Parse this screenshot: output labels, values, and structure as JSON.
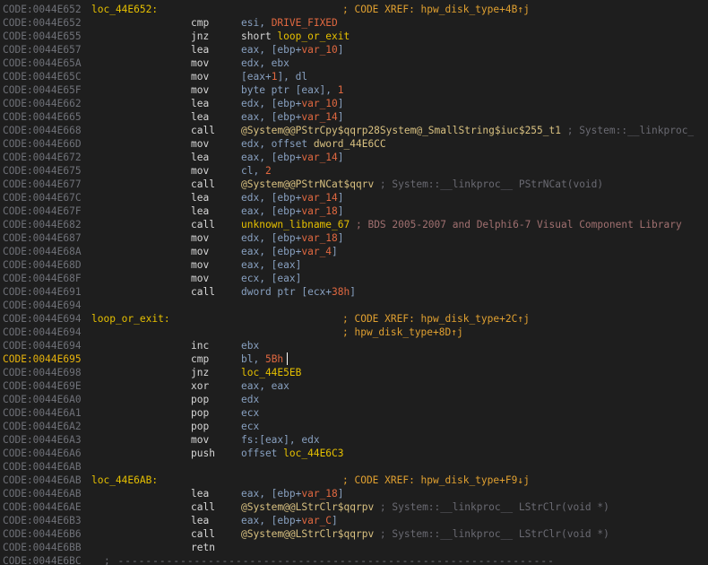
{
  "lines": [
    {
      "addr": "CODE:0044E652",
      "label": "loc_44E652:",
      "xref": "; CODE XREF: hpw_disk_type+4B↑j"
    },
    {
      "addr": "CODE:0044E652",
      "mn": "cmp",
      "ops": [
        {
          "t": "esi, ",
          "c": "r"
        },
        {
          "t": "DRIVE_FIXED",
          "c": "c"
        }
      ]
    },
    {
      "addr": "CODE:0044E655",
      "mn": "jnz",
      "ops": [
        {
          "t": "short ",
          "c": "t"
        },
        {
          "t": "loop_or_exit",
          "c": "f"
        }
      ]
    },
    {
      "addr": "CODE:0044E657",
      "mn": "lea",
      "ops": [
        {
          "t": "eax, [ebp+",
          "c": "r"
        },
        {
          "t": "var_10",
          "c": "v"
        },
        {
          "t": "]",
          "c": "r"
        }
      ]
    },
    {
      "addr": "CODE:0044E65A",
      "mn": "mov",
      "ops": [
        {
          "t": "edx, ebx",
          "c": "r"
        }
      ]
    },
    {
      "addr": "CODE:0044E65C",
      "mn": "mov",
      "ops": [
        {
          "t": "[eax+",
          "c": "r"
        },
        {
          "t": "1",
          "c": "c"
        },
        {
          "t": "], dl",
          "c": "r"
        }
      ]
    },
    {
      "addr": "CODE:0044E65F",
      "mn": "mov",
      "ops": [
        {
          "t": "byte ptr [eax], ",
          "c": "r"
        },
        {
          "t": "1",
          "c": "c"
        }
      ]
    },
    {
      "addr": "CODE:0044E662",
      "mn": "lea",
      "ops": [
        {
          "t": "edx, [ebp+",
          "c": "r"
        },
        {
          "t": "var_10",
          "c": "v"
        },
        {
          "t": "]",
          "c": "r"
        }
      ]
    },
    {
      "addr": "CODE:0044E665",
      "mn": "lea",
      "ops": [
        {
          "t": "eax, [ebp+",
          "c": "r"
        },
        {
          "t": "var_14",
          "c": "v"
        },
        {
          "t": "]",
          "c": "r"
        }
      ]
    },
    {
      "addr": "CODE:0044E668",
      "mn": "call",
      "ops": [
        {
          "t": "@System@@PStrCpy$qqrp28System@_SmallString$iuc$255_t1",
          "c": "fnc"
        },
        {
          "t": " ; System::__linkproc_",
          "c": "cm"
        }
      ]
    },
    {
      "addr": "CODE:0044E66D",
      "mn": "mov",
      "ops": [
        {
          "t": "edx, offset ",
          "c": "r"
        },
        {
          "t": "dword_44E6CC",
          "c": "fnc"
        }
      ]
    },
    {
      "addr": "CODE:0044E672",
      "mn": "lea",
      "ops": [
        {
          "t": "eax, [ebp+",
          "c": "r"
        },
        {
          "t": "var_14",
          "c": "v"
        },
        {
          "t": "]",
          "c": "r"
        }
      ]
    },
    {
      "addr": "CODE:0044E675",
      "mn": "mov",
      "ops": [
        {
          "t": "cl, ",
          "c": "r"
        },
        {
          "t": "2",
          "c": "c"
        }
      ]
    },
    {
      "addr": "CODE:0044E677",
      "mn": "call",
      "ops": [
        {
          "t": "@System@@PStrNCat$qqrv",
          "c": "fnc"
        },
        {
          "t": " ; System::__linkproc__ PStrNCat(void)",
          "c": "cm"
        }
      ]
    },
    {
      "addr": "CODE:0044E67C",
      "mn": "lea",
      "ops": [
        {
          "t": "edx, [ebp+",
          "c": "r"
        },
        {
          "t": "var_14",
          "c": "v"
        },
        {
          "t": "]",
          "c": "r"
        }
      ]
    },
    {
      "addr": "CODE:0044E67F",
      "mn": "lea",
      "ops": [
        {
          "t": "eax, [ebp+",
          "c": "r"
        },
        {
          "t": "var_18",
          "c": "v"
        },
        {
          "t": "]",
          "c": "r"
        }
      ]
    },
    {
      "addr": "CODE:0044E682",
      "mn": "call",
      "ops": [
        {
          "t": "unknown_libname_67",
          "c": "f"
        },
        {
          "t": " ; BDS 2005-2007 and Delphi6-7 Visual Component Library",
          "c": "cm2"
        }
      ]
    },
    {
      "addr": "CODE:0044E687",
      "mn": "mov",
      "ops": [
        {
          "t": "edx, [ebp+",
          "c": "r"
        },
        {
          "t": "var_18",
          "c": "v"
        },
        {
          "t": "]",
          "c": "r"
        }
      ]
    },
    {
      "addr": "CODE:0044E68A",
      "mn": "mov",
      "ops": [
        {
          "t": "eax, [ebp+",
          "c": "r"
        },
        {
          "t": "var_4",
          "c": "v"
        },
        {
          "t": "]",
          "c": "r"
        }
      ]
    },
    {
      "addr": "CODE:0044E68D",
      "mn": "mov",
      "ops": [
        {
          "t": "eax, [eax]",
          "c": "r"
        }
      ]
    },
    {
      "addr": "CODE:0044E68F",
      "mn": "mov",
      "ops": [
        {
          "t": "ecx, [eax]",
          "c": "r"
        }
      ]
    },
    {
      "addr": "CODE:0044E691",
      "mn": "call",
      "ops": [
        {
          "t": "dword ptr [ecx+",
          "c": "r"
        },
        {
          "t": "38h",
          "c": "c"
        },
        {
          "t": "]",
          "c": "r"
        }
      ]
    },
    {
      "addr": "CODE:0044E694"
    },
    {
      "addr": "CODE:0044E694",
      "label": "loop_or_exit:",
      "xref": "; CODE XREF: hpw_disk_type+2C↑j"
    },
    {
      "addr": "CODE:0044E694",
      "xref": "; hpw_disk_type+8D↑j"
    },
    {
      "addr": "CODE:0044E694",
      "mn": "inc",
      "ops": [
        {
          "t": "ebx",
          "c": "r"
        }
      ]
    },
    {
      "addr": "CODE:0044E695",
      "current": true,
      "mn": "cmp",
      "caret": true,
      "ops": [
        {
          "t": "bl, ",
          "c": "r"
        },
        {
          "t": "5Bh",
          "c": "c"
        }
      ]
    },
    {
      "addr": "CODE:0044E698",
      "mn": "jnz",
      "ops": [
        {
          "t": "loc_44E5EB",
          "c": "f"
        }
      ]
    },
    {
      "addr": "CODE:0044E69E",
      "mn": "xor",
      "ops": [
        {
          "t": "eax, eax",
          "c": "r"
        }
      ]
    },
    {
      "addr": "CODE:0044E6A0",
      "mn": "pop",
      "ops": [
        {
          "t": "edx",
          "c": "r"
        }
      ]
    },
    {
      "addr": "CODE:0044E6A1",
      "mn": "pop",
      "ops": [
        {
          "t": "ecx",
          "c": "r"
        }
      ]
    },
    {
      "addr": "CODE:0044E6A2",
      "mn": "pop",
      "ops": [
        {
          "t": "ecx",
          "c": "r"
        }
      ]
    },
    {
      "addr": "CODE:0044E6A3",
      "mn": "mov",
      "ops": [
        {
          "t": "fs:[eax], edx",
          "c": "r"
        }
      ]
    },
    {
      "addr": "CODE:0044E6A6",
      "mn": "push",
      "ops": [
        {
          "t": "offset ",
          "c": "r"
        },
        {
          "t": "loc_44E6C3",
          "c": "f"
        }
      ]
    },
    {
      "addr": "CODE:0044E6AB"
    },
    {
      "addr": "CODE:0044E6AB",
      "label": "loc_44E6AB:",
      "xref": "; CODE XREF: hpw_disk_type+F9↓j"
    },
    {
      "addr": "CODE:0044E6AB",
      "mn": "lea",
      "ops": [
        {
          "t": "eax, [ebp+",
          "c": "r"
        },
        {
          "t": "var_18",
          "c": "v"
        },
        {
          "t": "]",
          "c": "r"
        }
      ]
    },
    {
      "addr": "CODE:0044E6AE",
      "mn": "call",
      "ops": [
        {
          "t": "@System@@LStrClr$qqrpv",
          "c": "fnc"
        },
        {
          "t": " ; System::__linkproc__ LStrClr(void *)",
          "c": "cm"
        }
      ]
    },
    {
      "addr": "CODE:0044E6B3",
      "mn": "lea",
      "ops": [
        {
          "t": "eax, [ebp+",
          "c": "r"
        },
        {
          "t": "var_C",
          "c": "v"
        },
        {
          "t": "]",
          "c": "r"
        }
      ]
    },
    {
      "addr": "CODE:0044E6B6",
      "mn": "call",
      "ops": [
        {
          "t": "@System@@LStrClr$qqrpv",
          "c": "fnc"
        },
        {
          "t": " ; System::__linkproc__ LStrClr(void *)",
          "c": "cm"
        }
      ]
    },
    {
      "addr": "CODE:0044E6BB",
      "mn": "retn"
    },
    {
      "addr": "CODE:0044E6BC",
      "sep": "; ---------------------------------------------------------------"
    }
  ]
}
